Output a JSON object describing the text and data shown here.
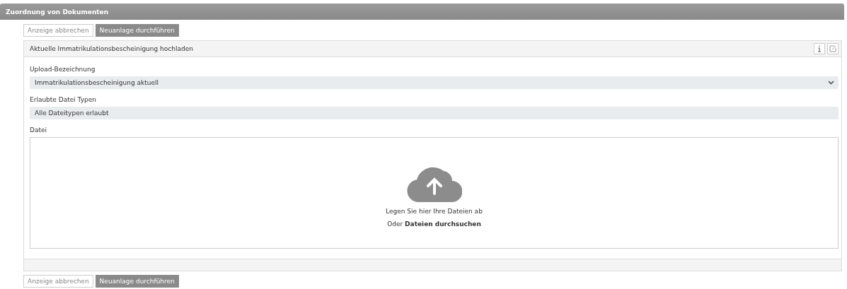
{
  "header": {
    "title": "Zuordnung von Dokumenten"
  },
  "top_buttons": [
    {
      "label": "Anzeige abbrechen",
      "kind": "secondary"
    },
    {
      "label": "Neuanlage durchführen",
      "kind": "primary"
    }
  ],
  "panel": {
    "title": "Aktuelle Immatrikulationsbescheinigung hochladen",
    "fields": [
      {
        "kind": "select",
        "label": "Upload-Bezeichnung",
        "value": "Immatrikulationsbescheinigung aktuell"
      },
      {
        "kind": "readonly",
        "label": "Erlaubte Datei Typen",
        "value": "Alle Dateitypen erlaubt"
      },
      {
        "kind": "dropzone",
        "label": "Datei",
        "hint": "Legen Sie hier Ihre Dateien ab",
        "prefix": "Oder",
        "link": "Dateien durchsuchen"
      }
    ]
  },
  "bottom_buttons": [
    {
      "label": "Anzeige abbrechen",
      "kind": "secondary"
    },
    {
      "label": "Neuanlage durchführen",
      "kind": "primary"
    }
  ]
}
